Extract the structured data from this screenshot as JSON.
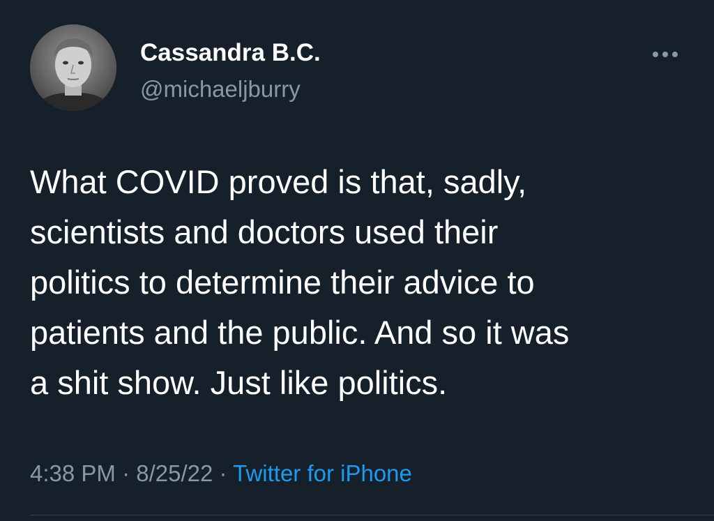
{
  "author": {
    "display_name": "Cassandra B.C.",
    "handle": "@michaeljburry",
    "avatar_icon": "profile-photo-icon"
  },
  "tweet": {
    "text": "What COVID proved is that, sadly,\nscientists and doctors used their\npolitics to determine their advice to\npatients and the public. And so it was\na shit show. Just like politics.",
    "time": "4:38 PM",
    "date": "8/25/22",
    "separator": "·",
    "source": "Twitter for iPhone"
  },
  "icons": {
    "more": "more-options-icon"
  },
  "colors": {
    "background": "#15202b",
    "primary_text": "#ffffff",
    "secondary_text": "#8899a6",
    "link": "#1d9bf0"
  }
}
